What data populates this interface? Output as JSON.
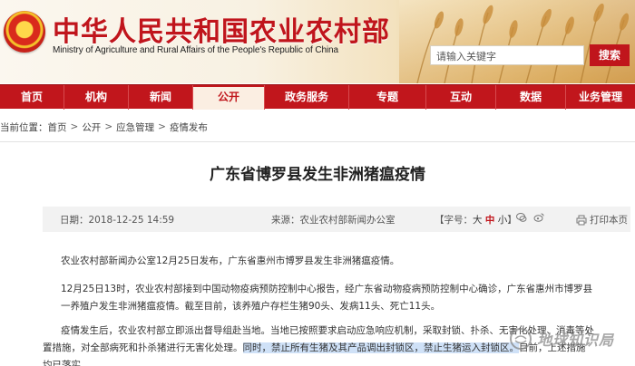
{
  "header": {
    "title": "中华人民共和国农业农村部",
    "subtitle": "Ministry of Agriculture and Rural Affairs of the People's Republic of China",
    "search_placeholder": "请输入关键字",
    "search_button": "搜索"
  },
  "nav": {
    "items": [
      {
        "label": "首页"
      },
      {
        "label": "机构"
      },
      {
        "label": "新闻"
      },
      {
        "label": "公开",
        "active": true
      },
      {
        "label": "政务服务"
      },
      {
        "label": "专题"
      },
      {
        "label": "互动"
      },
      {
        "label": "数据"
      },
      {
        "label": "业务管理"
      }
    ]
  },
  "breadcrumb": {
    "prefix": "当前位置：",
    "items": [
      "首页",
      "公开",
      "应急管理",
      "疫情发布"
    ],
    "separator": ">"
  },
  "article": {
    "title": "广东省博罗县发生非洲猪瘟疫情",
    "date": "日期：2018-12-25 14:59",
    "source": "来源：农业农村部新闻办公室",
    "fontsize_prefix": "【字号：",
    "fontsize_big": "大",
    "fontsize_mid": "中",
    "fontsize_small": "小",
    "fontsize_suffix": "】",
    "print": "打印本页",
    "paragraphs": {
      "p1": "农业农村部新闻办公室12月25日发布，广东省惠州市博罗县发生非洲猪瘟疫情。",
      "p2": "12月25日13时，农业农村部接到中国动物疫病预防控制中心报告，经广东省动物疫病预防控制中心确诊，广东省惠州市博罗县一养殖户发生非洲猪瘟疫情。截至目前，该养殖户存栏生猪90头、发病11头、死亡11头。",
      "p3_a": "疫情发生后，农业农村部立即派出督导组赴当地。当地已按照要求启动应急响应机制，采取封锁、扑杀、无害化处理、消毒等处置措施，对全部病死和扑杀猪进行无害化处理。",
      "p3_b": "同时，禁止所有生猪及其产品调出封锁区，禁止生猪运入封锁区。",
      "p3_c": "目前，上述措施均已落实。"
    }
  },
  "watermark": {
    "text": "地球知识局"
  },
  "colors": {
    "brand_red": "#c1161c",
    "meta_bg": "#f2f2f2",
    "highlight": "#cfe1f7"
  }
}
